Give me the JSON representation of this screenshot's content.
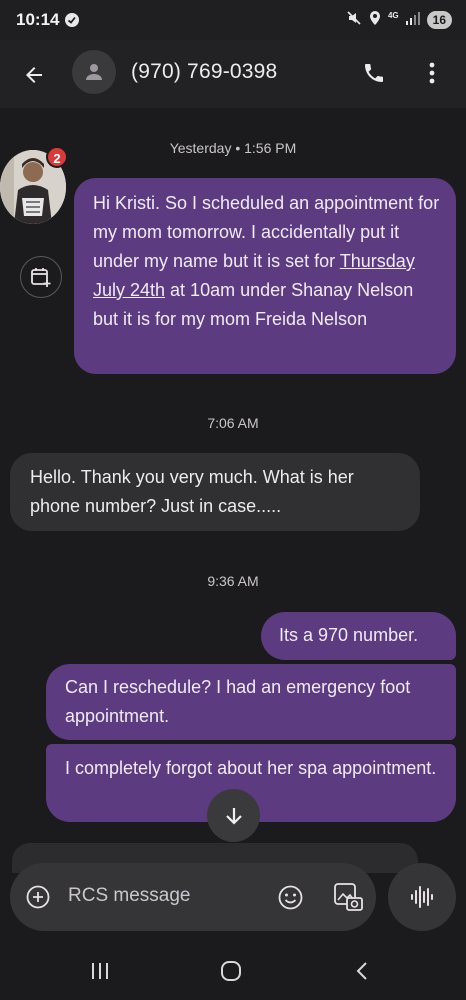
{
  "status_bar": {
    "time": "10:14",
    "network": "4G",
    "battery": "16"
  },
  "header": {
    "contact": "(970) 769-0398",
    "back_icon": "arrow-back-icon",
    "call_icon": "phone-icon",
    "more_icon": "more-vert-icon"
  },
  "thread": {
    "timestamps": [
      "Yesterday • 1:56 PM",
      "7:06 AM",
      "9:36 AM"
    ],
    "unread_count": "2",
    "message1": {
      "before": "Hi Kristi. So I scheduled an appointment for my mom tomorrow. I accidentally put it under my name but it is set for ",
      "link": "Thursday July 24th",
      "after": " at 10am under Shanay Nelson but it is for my mom Freida Nelson"
    },
    "message2": "Hello. Thank you very much. What is her phone number?  Just in case.....",
    "message3": "Its a 970 number.",
    "message4": "Can I reschedule? I had an emergency foot appointment.",
    "message5": "I completely forgot about her spa appointment."
  },
  "composer": {
    "placeholder": "RCS message"
  },
  "colors": {
    "outgoing_bubble": "#5c3b80",
    "incoming_bubble": "#303033",
    "background": "#1b1b1d",
    "badge": "#d93a3a"
  }
}
